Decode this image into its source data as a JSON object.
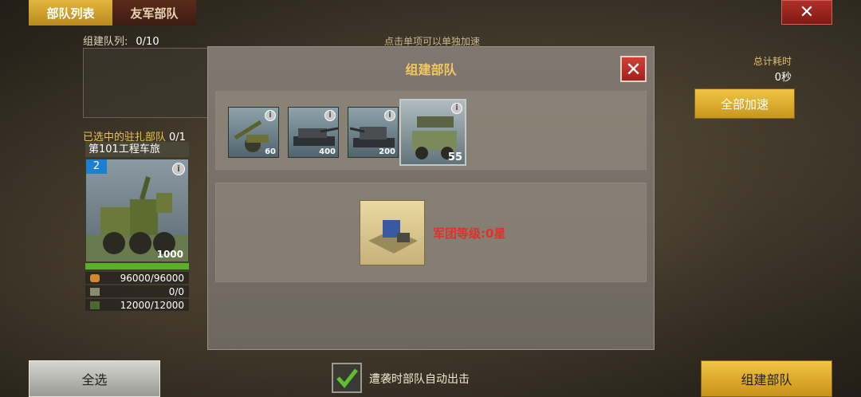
{
  "tabs": [
    {
      "label": "部队列表",
      "active": true
    },
    {
      "label": "友军部队",
      "active": false
    }
  ],
  "queue": {
    "label": "组建队列:",
    "count": "0/10"
  },
  "hint": "点击单项可以单独加速",
  "total_time": {
    "label": "总计耗时",
    "value": "0秒"
  },
  "speed_all_label": "全部加速",
  "garrison": {
    "title": "已选中的驻扎部队",
    "count": "0/1",
    "unit_name": "第101工程车旅",
    "level": "2",
    "unit_count": "1000",
    "resources": [
      {
        "icon": "bread-icon",
        "value": "96000/96000"
      },
      {
        "icon": "ammo-icon",
        "value": "0/0"
      },
      {
        "icon": "fuel-icon",
        "value": "12000/12000"
      }
    ]
  },
  "modal": {
    "title": "组建部队",
    "units": [
      {
        "icon": "artillery-icon",
        "count": "60"
      },
      {
        "icon": "tank-icon",
        "count": "400"
      },
      {
        "icon": "tank-destroyer-icon",
        "count": "200"
      },
      {
        "icon": "rocket-truck-icon",
        "count": "55"
      }
    ],
    "legion_text": "军团等级:0星"
  },
  "bottom": {
    "select_all": "全选",
    "auto_label": "遭袭时部队自动出击",
    "auto_checked": true,
    "build_label": "组建部队"
  },
  "colors": {
    "accent": "#e2b53c",
    "danger": "#b03028",
    "legion_text": "#e0302a"
  }
}
